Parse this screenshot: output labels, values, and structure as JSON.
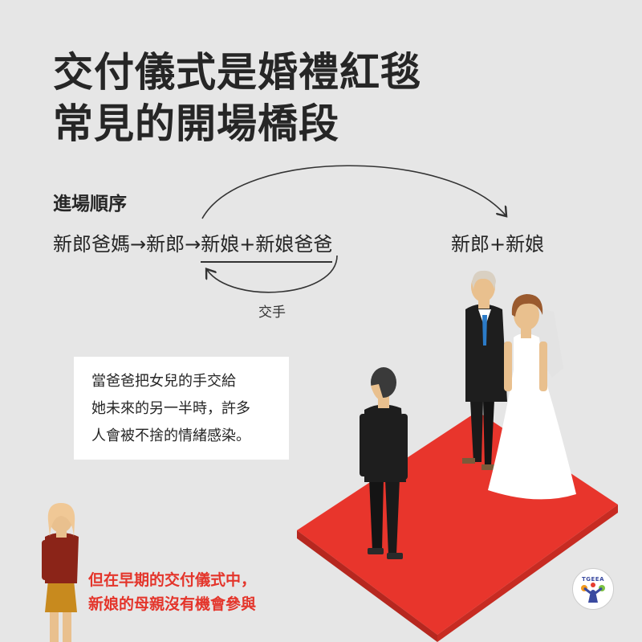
{
  "title": {
    "line1": "交付儀式是婚禮紅毯",
    "line2": "常見的開場橋段"
  },
  "order": {
    "heading": "進場順序",
    "step1": "新郎爸媽→新郎→",
    "step2": "新娘+新娘爸爸",
    "result": "新郎+新娘",
    "handoff_label": "交手"
  },
  "quote": {
    "line1": "當爸爸把女兒的手交給",
    "line2": "她未來的另一半時，許多",
    "line3": "人會被不捨的情緒感染。"
  },
  "note": {
    "line1": "但在早期的交付儀式中，",
    "line2": "新娘的母親沒有機會參與"
  },
  "logo": {
    "text": "TGEEA"
  },
  "colors": {
    "background": "#e6e6e6",
    "carpet": "#e8352c",
    "accent_red": "#e4352b",
    "suit": "#1a1a1a",
    "tie": "#2b7bc8"
  }
}
